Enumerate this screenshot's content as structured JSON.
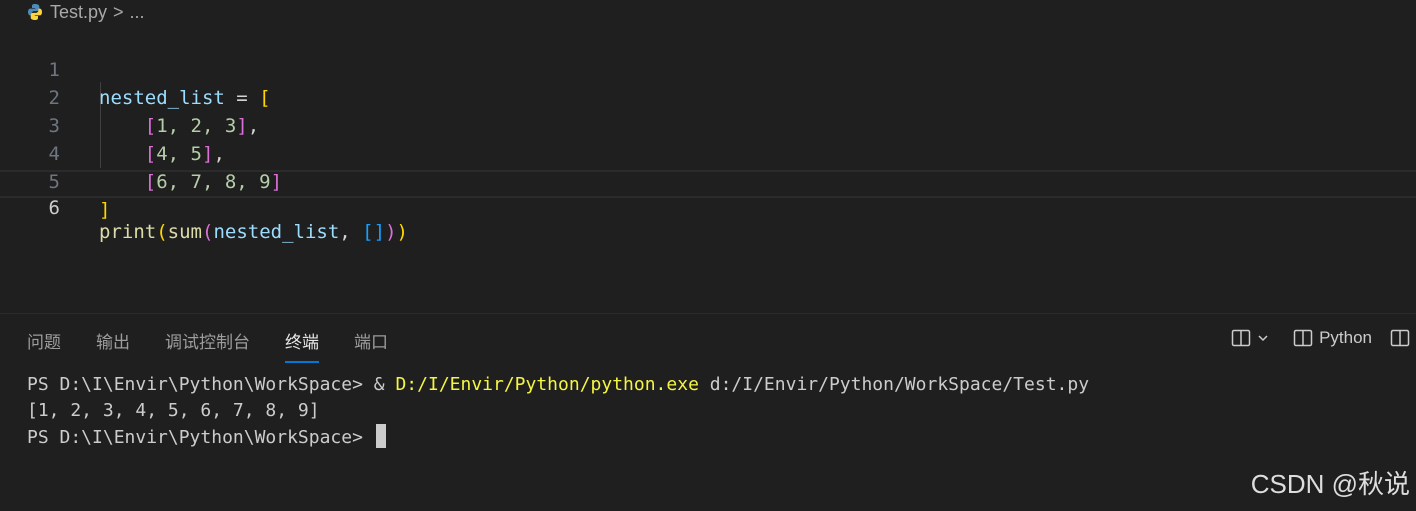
{
  "breadcrumb": {
    "file": "Test.py",
    "separator": ">",
    "rest": "..."
  },
  "editor": {
    "line_numbers": [
      "1",
      "2",
      "3",
      "4",
      "5",
      "6"
    ],
    "lines": {
      "l1": {
        "var": "nested_list",
        "eq": " = ",
        "open": "["
      },
      "l2": {
        "open": "[",
        "content": "1, 2, 3",
        "close": "]",
        "comma": ","
      },
      "l3": {
        "open": "[",
        "content": "4, 5",
        "close": "]",
        "comma": ","
      },
      "l4": {
        "open": "[",
        "content": "6, 7, 8, 9",
        "close": "]"
      },
      "l5": {
        "close": "]"
      },
      "l6": {
        "print": "print",
        "p1": "(",
        "sum": "sum",
        "p2": "(",
        "arg": "nested_list",
        "comma": ", ",
        "lb": "[",
        "rb": "]",
        "p2c": ")",
        "p1c": ")"
      }
    }
  },
  "panel": {
    "tabs": [
      "问题",
      "输出",
      "调试控制台",
      "终端",
      "端口"
    ],
    "active_tab": "终端",
    "terminal_profile": "Python"
  },
  "terminal": {
    "line1_prompt": "PS D:\\I\\Envir\\Python\\WorkSpace> ",
    "line1_amp": "& ",
    "line1_exe": "D:/I/Envir/Python/python.exe",
    "line1_arg": " d:/I/Envir/Python/WorkSpace/Test.py",
    "line2": "[1, 2, 3, 4, 5, 6, 7, 8, 9]",
    "line3_prompt": "PS D:\\I\\Envir\\Python\\WorkSpace> "
  },
  "watermark": "CSDN @秋说",
  "colors": {
    "accent": "#0078d4",
    "background": "#1f1f1f",
    "cmd_yellow": "#f5f543"
  },
  "icons": [
    "python-icon",
    "split-terminal-icon",
    "chevron-down-icon",
    "terminal-icon",
    "layout-icon"
  ]
}
